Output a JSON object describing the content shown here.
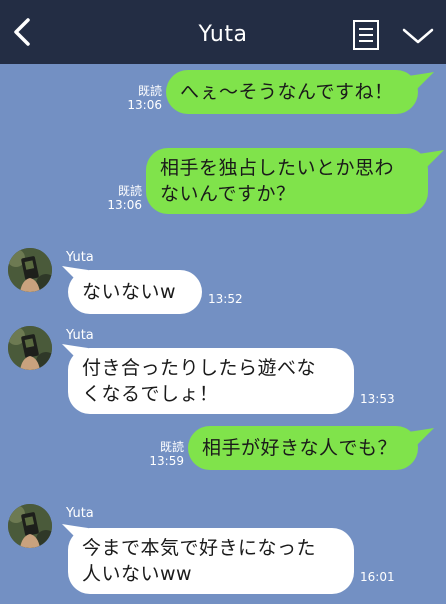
{
  "header": {
    "title": "Yuta"
  },
  "icons": {
    "back": "chevron-left-icon",
    "note": "note-icon",
    "menu": "chevron-down-icon"
  },
  "colors": {
    "background": "#7390c3",
    "header": "#232d44",
    "outgoing": "#80e34b",
    "incoming": "#ffffff"
  },
  "messages": [
    {
      "side": "right",
      "read": "既読",
      "time": "13:06",
      "text": "へぇ〜そうなんですね！"
    },
    {
      "side": "right",
      "read": "既読",
      "time": "13:06",
      "line1": "相手を独占したいとか思わ",
      "line2": "ないんですか？"
    },
    {
      "side": "left",
      "sender": "Yuta",
      "time": "13:52",
      "text": "ないないw"
    },
    {
      "side": "left",
      "sender": "Yuta",
      "time": "13:53",
      "line1": "付き合ったりしたら遊べな",
      "line2": "くなるでしょ！"
    },
    {
      "side": "right",
      "read": "既読",
      "time": "13:59",
      "text": "相手が好きな人でも？"
    },
    {
      "side": "left",
      "sender": "Yuta",
      "time": "16:01",
      "line1": "今まで本気で好きになった",
      "line2": "人いないww"
    }
  ]
}
